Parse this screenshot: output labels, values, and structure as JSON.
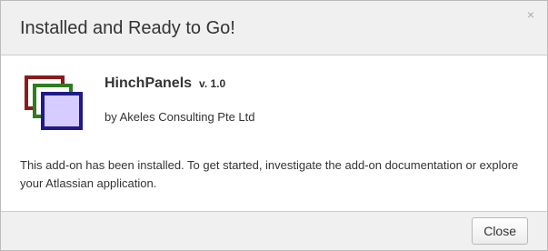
{
  "dialog": {
    "title": "Installed and Ready to Go!",
    "close_icon": "×"
  },
  "addon": {
    "name": "HinchPanels",
    "version": "v. 1.0",
    "vendor": "by Akeles Consulting Pte Ltd",
    "icon": "stacked-panels-icon",
    "icon_colors": {
      "back_panel": "#8b1a1a",
      "middle_panel": "#2e7d1e",
      "front_panel_border": "#1f1a8a",
      "front_panel_fill": "#d6ccff"
    }
  },
  "message": "This add-on has been installed. To get started, investigate the add-on documentation or explore your Atlassian application.",
  "footer": {
    "close_label": "Close"
  }
}
